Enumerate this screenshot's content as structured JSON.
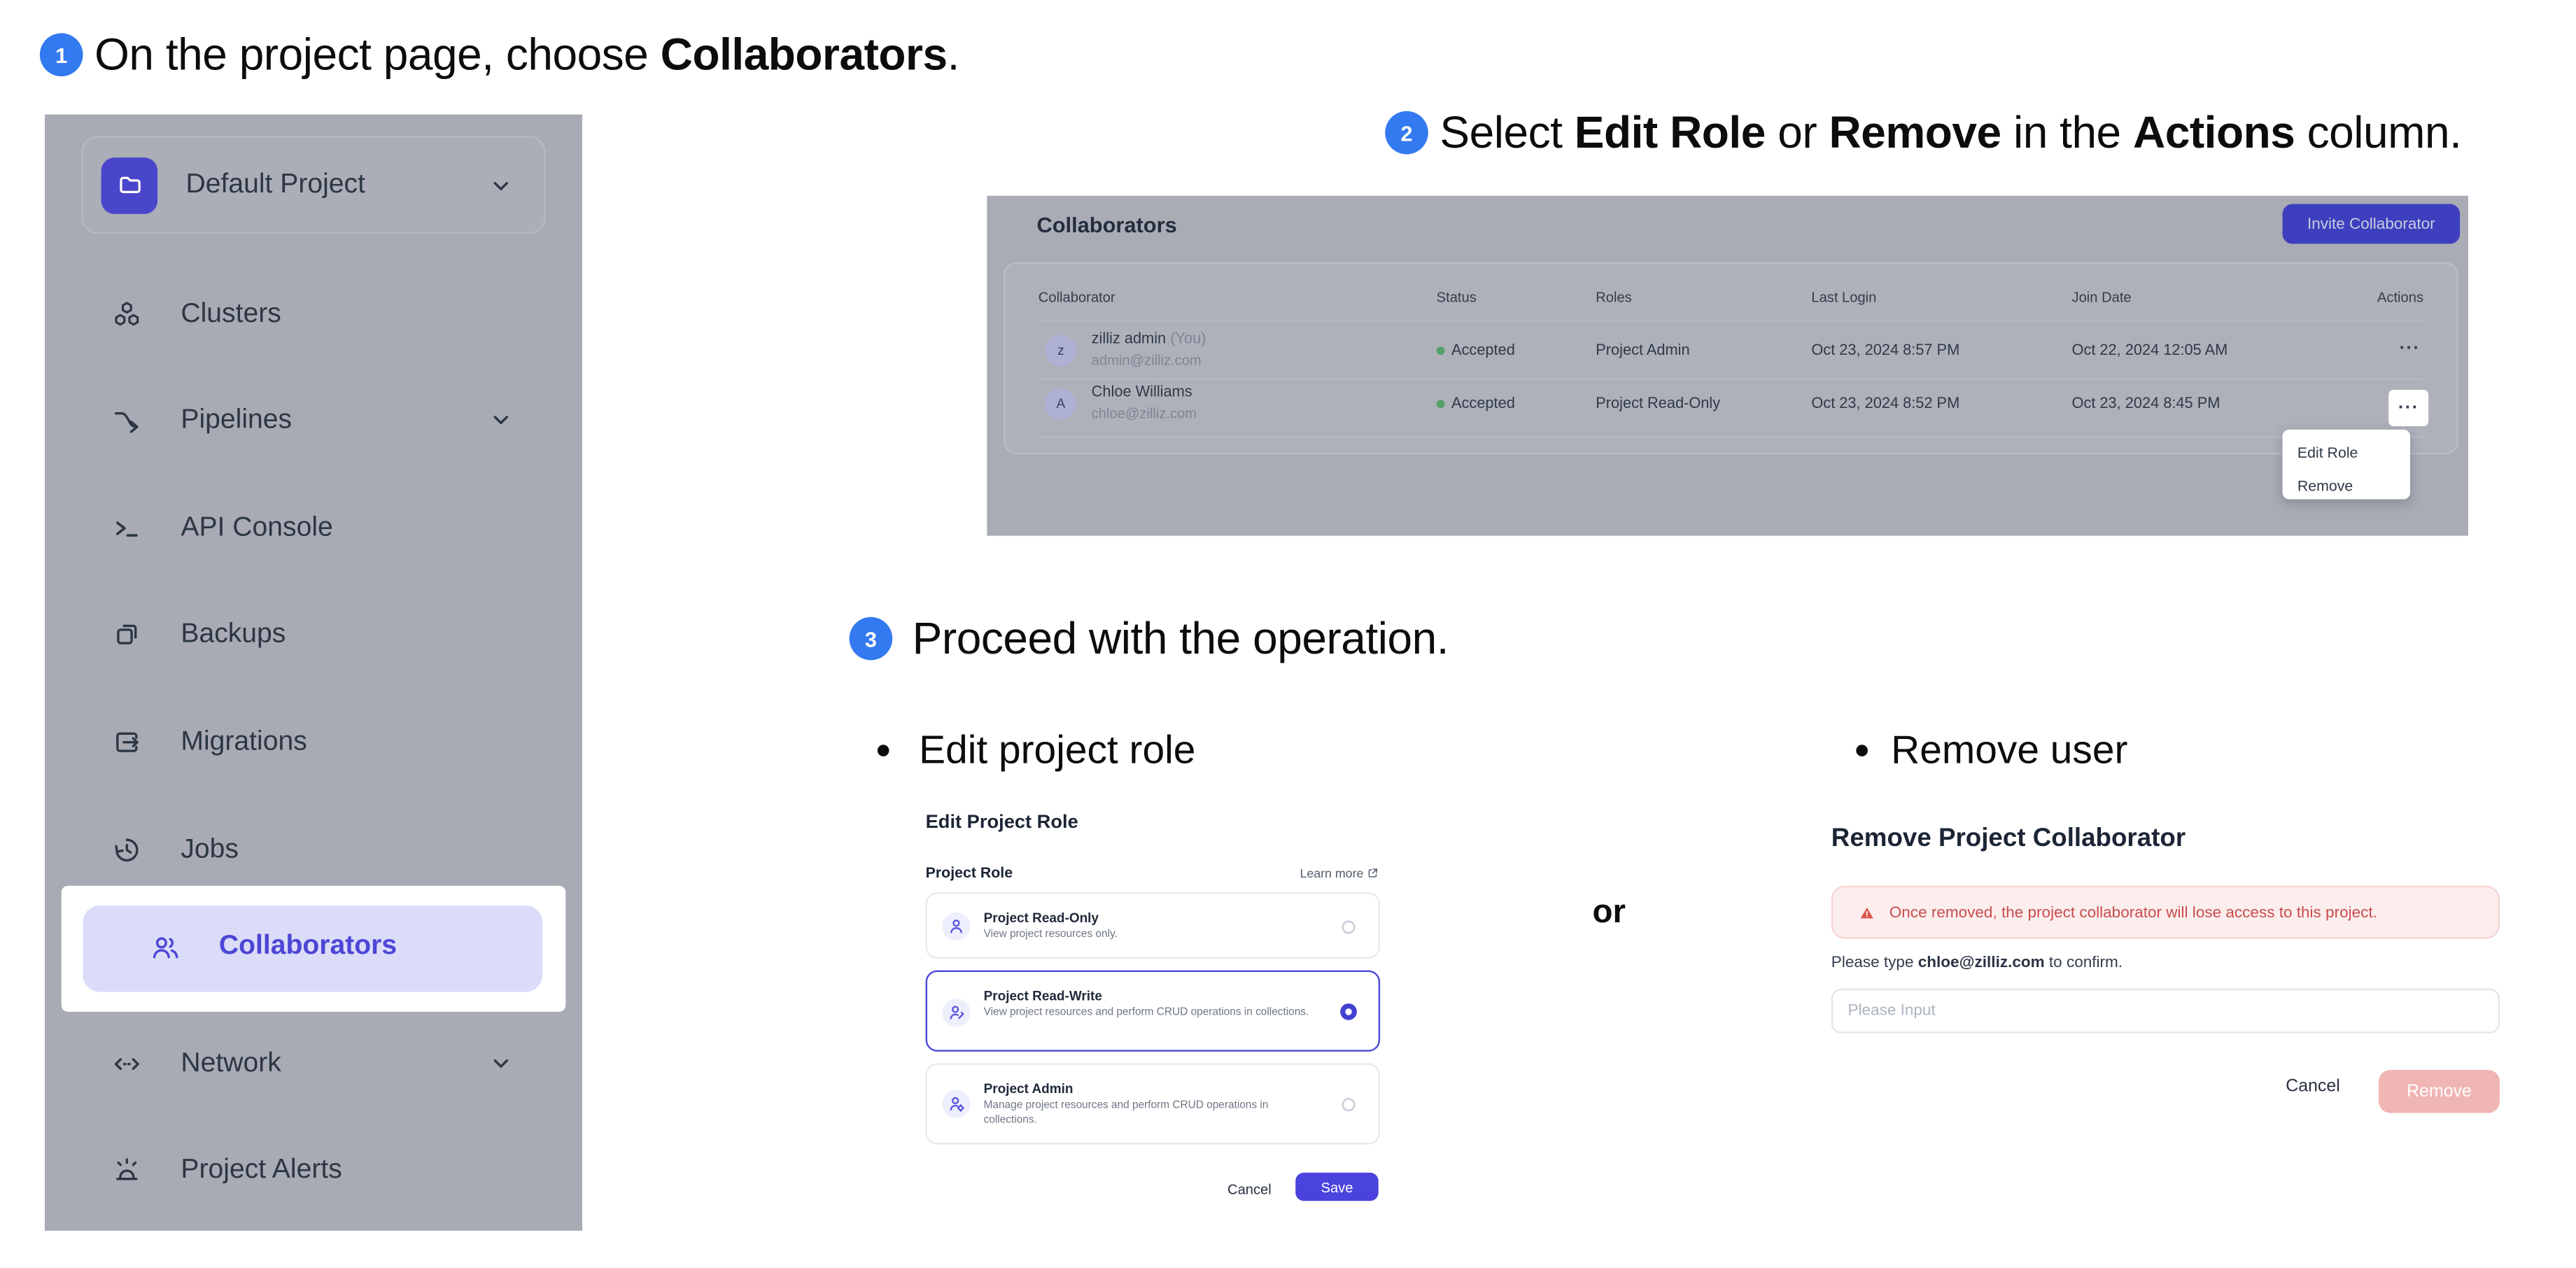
{
  "steps": {
    "s1": {
      "num": "1",
      "parts": [
        "On the project page, choose ",
        "Collaborators",
        "."
      ]
    },
    "s2": {
      "num": "2",
      "parts": [
        "Select ",
        "Edit Role",
        " or ",
        "Remove",
        " in the ",
        "Actions",
        " column."
      ]
    },
    "s3": {
      "num": "3",
      "text": "Proceed with the operation."
    }
  },
  "sidebar": {
    "project": "Default Project",
    "items": [
      {
        "label": "Clusters"
      },
      {
        "label": "Pipelines"
      },
      {
        "label": "API Console"
      },
      {
        "label": "Backups"
      },
      {
        "label": "Migrations"
      },
      {
        "label": "Jobs"
      },
      {
        "label": "Collaborators"
      },
      {
        "label": "Network"
      },
      {
        "label": "Project Alerts"
      }
    ]
  },
  "panel": {
    "title": "Collaborators",
    "invite": "Invite Collaborator",
    "columns": [
      "Collaborator",
      "Status",
      "Roles",
      "Last Login",
      "Join Date",
      "Actions"
    ],
    "rows": [
      {
        "avatar": "z",
        "name": "zilliz admin",
        "suffix": "(You)",
        "email": "admin@zilliz.com",
        "status": "Accepted",
        "role": "Project Admin",
        "last_login": "Oct 23, 2024 8:57 PM",
        "join_date": "Oct 22, 2024 12:05 AM",
        "actions": "···"
      },
      {
        "avatar": "A",
        "name": "Chloe Williams",
        "suffix": "",
        "email": "chloe@zilliz.com",
        "status": "Accepted",
        "role": "Project Read-Only",
        "last_login": "Oct 23, 2024 8:52 PM",
        "join_date": "Oct 23, 2024 8:45 PM",
        "actions": "···"
      }
    ],
    "menu": [
      "Edit Role",
      "Remove"
    ]
  },
  "bullets": {
    "edit": "Edit project role",
    "or": "or",
    "remove": "Remove user"
  },
  "edit_dialog": {
    "title": "Edit Project Role",
    "section": "Project Role",
    "learn_more": "Learn more",
    "options": [
      {
        "title": "Project Read-Only",
        "desc": "View project resources only.",
        "selected": false
      },
      {
        "title": "Project Read-Write",
        "desc": "View project resources and perform CRUD operations in collections.",
        "selected": true
      },
      {
        "title": "Project Admin",
        "desc": "Manage project resources and perform CRUD operations in collections.",
        "selected": false
      }
    ],
    "cancel": "Cancel",
    "save": "Save"
  },
  "remove_dialog": {
    "title": "Remove Project Collaborator",
    "warning": "Once removed, the project collaborator will lose access to this project.",
    "confirm": [
      "Please type ",
      "chloe@zilliz.com",
      " to confirm."
    ],
    "placeholder": "Please Input",
    "cancel": "Cancel",
    "remove": "Remove"
  },
  "colors": {
    "accent": "#4b43dd",
    "invite_dimmed": "#3e3fbe",
    "badge_blue": "#3379f0",
    "pill_bg": "#dbdcf8",
    "pill_text": "#4c46d6",
    "status_green": "#55a06b",
    "alert_bg": "#fdeeee",
    "alert_text": "#c94c4c",
    "remove_disabled": "#f0b6b4",
    "dim_overlay": "#a8abb4"
  }
}
